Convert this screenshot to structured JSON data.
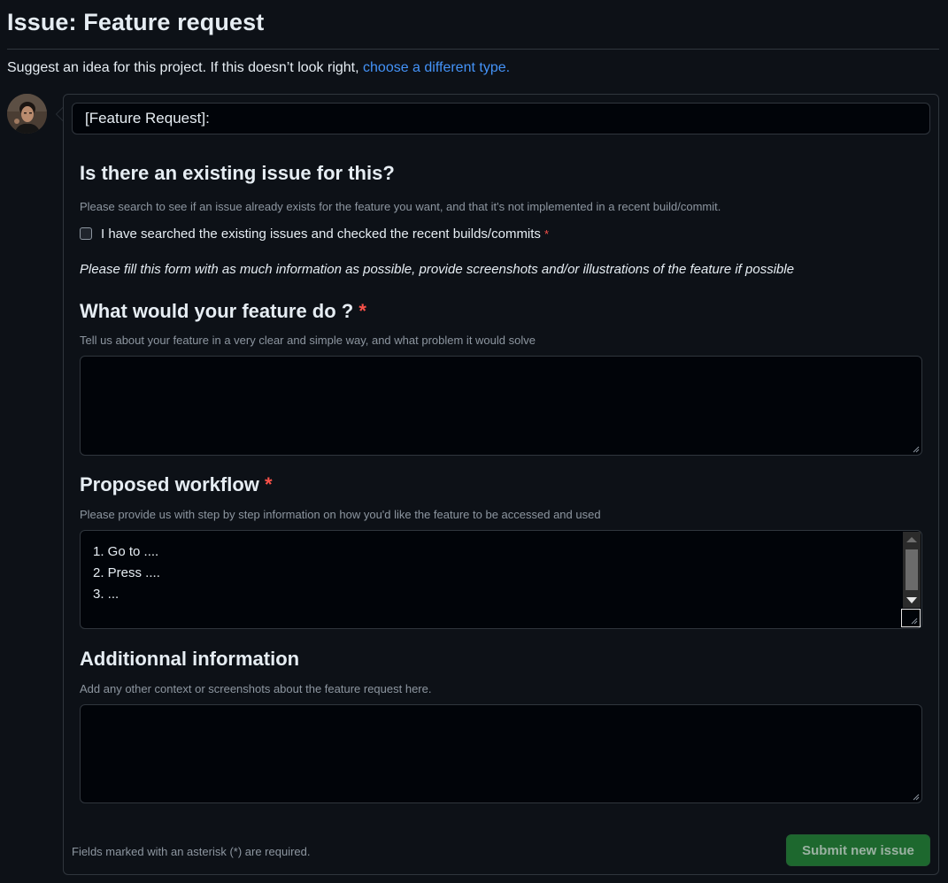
{
  "header": {
    "title": "Issue: Feature request",
    "subtitle_text": "Suggest an idea for this project. If this doesn’t look right,",
    "subtitle_link": "choose a different type."
  },
  "form": {
    "title_value": "[Feature Request]:",
    "existing_issue": {
      "heading": "Is there an existing issue for this?",
      "description": "Please search to see if an issue already exists for the feature you want, and that it's not implemented in a recent build/commit.",
      "checkbox_label": "I have searched the existing issues and checked the recent builds/commits",
      "checked": false
    },
    "note": "Please fill this form with as much information as possible, provide screenshots and/or illustrations of the feature if possible",
    "feature": {
      "heading": "What would your feature do ?",
      "description": "Tell us about your feature in a very clear and simple way, and what problem it would solve",
      "value": ""
    },
    "workflow": {
      "heading": "Proposed workflow",
      "description": "Please provide us with step by step information on how you'd like the feature to be accessed and used",
      "lines": [
        "1. Go to ....",
        "2. Press ....",
        "3. ..."
      ]
    },
    "additional": {
      "heading": "Additionnal information",
      "description": "Add any other context or screenshots about the feature request here.",
      "value": ""
    },
    "required_marker": "*",
    "footer_note": "Fields marked with an asterisk (*) are required.",
    "submit_label": "Submit new issue"
  },
  "colors": {
    "background": "#0d1117",
    "link": "#4493f8",
    "required": "#f85149",
    "submit": "#238636"
  },
  "icons": [
    "avatar",
    "resize-grip-icon",
    "scroll-up-icon",
    "scroll-down-icon"
  ]
}
